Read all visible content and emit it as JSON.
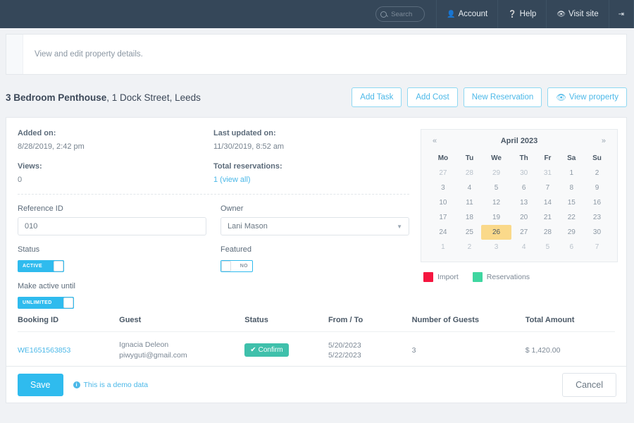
{
  "topnav": {
    "search": {
      "placeholder": "Search",
      "value": ""
    },
    "items": [
      {
        "label": "Account",
        "icon": "user-icon",
        "glyph": "▲"
      },
      {
        "label": "Help",
        "icon": "question-circle-icon",
        "glyph": "?"
      },
      {
        "label": "Visit site",
        "icon": "eye-icon",
        "glyph": "◉"
      }
    ],
    "logout": {
      "label": "",
      "icon": "logout-icon",
      "glyph": "→"
    }
  },
  "description": {
    "text": "View and edit property details."
  },
  "header": {
    "title_bold": "3 Bedroom Penthouse",
    "title_rest": ", 1 Dock Street, Leeds",
    "buttons": [
      {
        "label": "Add Task",
        "icon": ""
      },
      {
        "label": "Add Cost",
        "icon": ""
      },
      {
        "label": "New Reservation",
        "icon": ""
      },
      {
        "label": "View property",
        "icon": "eye-icon"
      }
    ]
  },
  "meta": {
    "added_on_label": "Added on:",
    "added_on_value": "8/28/2019, 2:42 pm",
    "last_updated_label": "Last updated on:",
    "last_updated_value": "11/30/2019, 8:52 am",
    "views_label": "Views:",
    "views_value": "0",
    "total_reservations_label": "Total reservations:",
    "total_reservations_value": "1 (view all)"
  },
  "form": {
    "reference_id": {
      "label": "Reference ID",
      "value": "010"
    },
    "owner": {
      "label": "Owner",
      "value": "Lani Mason"
    },
    "status": {
      "label": "Status",
      "toggle_label": "ACTIVE",
      "state": "on"
    },
    "featured": {
      "label": "Featured",
      "toggle_label": "NO",
      "state": "off"
    },
    "make_active_until": {
      "label": "Make active until",
      "toggle_label": "UNLIMITED",
      "state": "on"
    }
  },
  "calendar": {
    "title": "April 2023",
    "prev": "«",
    "next": "»",
    "weekdays": [
      "Mo",
      "Tu",
      "We",
      "Th",
      "Fr",
      "Sa",
      "Su"
    ],
    "weeks": [
      [
        {
          "d": "27",
          "out": true
        },
        {
          "d": "28",
          "out": true
        },
        {
          "d": "29",
          "out": true
        },
        {
          "d": "30",
          "out": true
        },
        {
          "d": "31",
          "out": true
        },
        {
          "d": "1",
          "out": false
        },
        {
          "d": "2",
          "out": false
        }
      ],
      [
        {
          "d": "3",
          "out": false
        },
        {
          "d": "4",
          "out": false
        },
        {
          "d": "5",
          "out": false
        },
        {
          "d": "6",
          "out": false
        },
        {
          "d": "7",
          "out": false
        },
        {
          "d": "8",
          "out": false
        },
        {
          "d": "9",
          "out": false
        }
      ],
      [
        {
          "d": "10",
          "out": false
        },
        {
          "d": "11",
          "out": false
        },
        {
          "d": "12",
          "out": false
        },
        {
          "d": "13",
          "out": false
        },
        {
          "d": "14",
          "out": false
        },
        {
          "d": "15",
          "out": false
        },
        {
          "d": "16",
          "out": false
        }
      ],
      [
        {
          "d": "17",
          "out": false
        },
        {
          "d": "18",
          "out": false
        },
        {
          "d": "19",
          "out": false
        },
        {
          "d": "20",
          "out": false
        },
        {
          "d": "21",
          "out": false
        },
        {
          "d": "22",
          "out": false
        },
        {
          "d": "23",
          "out": false
        }
      ],
      [
        {
          "d": "24",
          "out": false
        },
        {
          "d": "25",
          "out": false
        },
        {
          "d": "26",
          "out": false,
          "selected": true
        },
        {
          "d": "27",
          "out": false
        },
        {
          "d": "28",
          "out": false
        },
        {
          "d": "29",
          "out": false
        },
        {
          "d": "30",
          "out": false
        }
      ],
      [
        {
          "d": "1",
          "out": true
        },
        {
          "d": "2",
          "out": true
        },
        {
          "d": "3",
          "out": true
        },
        {
          "d": "4",
          "out": true
        },
        {
          "d": "5",
          "out": true
        },
        {
          "d": "6",
          "out": true
        },
        {
          "d": "7",
          "out": true
        }
      ]
    ],
    "selected_day": "26",
    "legend": [
      {
        "label": "Import",
        "color": "#f5163f"
      },
      {
        "label": "Reservations",
        "color": "#3fd6a0"
      }
    ]
  },
  "bookings": {
    "columns": [
      "Booking ID",
      "Guest",
      "Status",
      "From / To",
      "Number of Guests",
      "Total Amount"
    ],
    "rows": [
      {
        "booking_id": "WE1651563853",
        "guest_name": "Ignacia Deleon",
        "guest_email": "piwyguti@gmail.com",
        "status": "Confirm",
        "from": "5/20/2023",
        "to": "5/22/2023",
        "guests": "3",
        "amount": "$ 1,420.00"
      }
    ]
  },
  "footer": {
    "save_label": "Save",
    "demo_note": "This is a demo data",
    "cancel_label": "Cancel"
  }
}
